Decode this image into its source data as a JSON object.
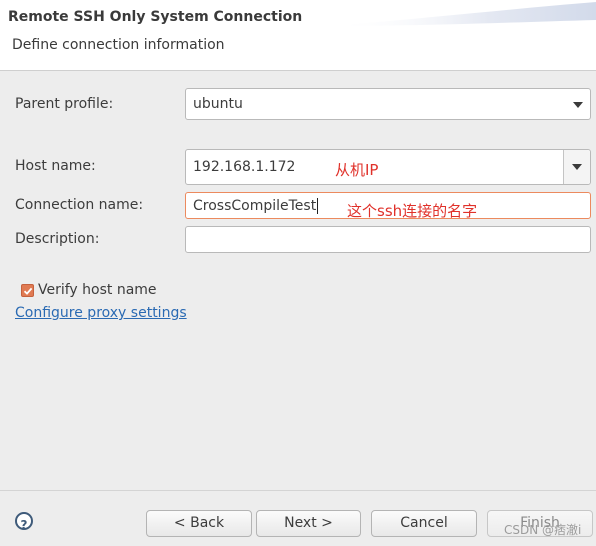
{
  "dialog": {
    "title": "Remote SSH Only System Connection",
    "subtitle": "Define connection information"
  },
  "form": {
    "parent_profile": {
      "label": "Parent profile:",
      "value": "ubuntu"
    },
    "host_name": {
      "label": "Host name:",
      "value": "192.168.1.172"
    },
    "connection_name": {
      "label": "Connection name:",
      "value": "CrossCompileTest"
    },
    "description": {
      "label": "Description:",
      "value": ""
    },
    "verify_host": {
      "label": "Verify host name",
      "checked": true
    },
    "proxy_link": "Configure proxy settings"
  },
  "annotations": {
    "host": "从机IP",
    "connection": "这个ssh连接的名字"
  },
  "buttons": {
    "help": "?",
    "back": "< Back",
    "next": "Next >",
    "cancel": "Cancel",
    "finish": "Finish"
  },
  "watermark": "CSDN @痞澈i",
  "colors": {
    "accent": "#e07a52",
    "link": "#2a6ab3",
    "annotation": "#e0312a"
  },
  "icons": {
    "dropdown": "triangle-down",
    "help": "question-circle",
    "check": "checkmark"
  }
}
